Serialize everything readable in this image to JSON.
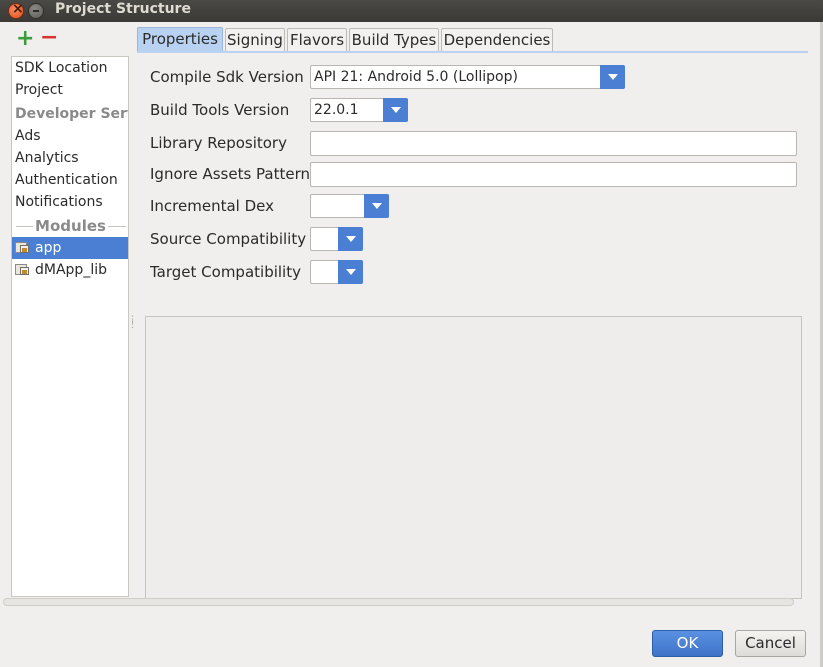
{
  "window": {
    "title": "Project Structure"
  },
  "sidebar": {
    "add_symbol": "+",
    "remove_symbol": "−",
    "items": [
      {
        "label": "SDK Location"
      },
      {
        "label": "Project"
      }
    ],
    "developer_section": "Developer Services",
    "services": [
      {
        "label": "Ads"
      },
      {
        "label": "Analytics"
      },
      {
        "label": "Authentication"
      },
      {
        "label": "Notifications"
      }
    ],
    "modules_header": "Modules",
    "modules": [
      {
        "label": "app",
        "selected": true
      },
      {
        "label": "dMApp_lib",
        "selected": false
      }
    ]
  },
  "tabs": [
    {
      "label": "Properties",
      "active": true
    },
    {
      "label": "Signing"
    },
    {
      "label": "Flavors"
    },
    {
      "label": "Build Types"
    },
    {
      "label": "Dependencies"
    }
  ],
  "form": {
    "compile_sdk": {
      "label": "Compile Sdk Version",
      "value": "API 21: Android 5.0 (Lollipop)"
    },
    "build_tools": {
      "label": "Build Tools Version",
      "value": "22.0.1"
    },
    "library_repository": {
      "label": "Library Repository",
      "value": ""
    },
    "ignore_assets": {
      "label": "Ignore Assets Pattern",
      "value": ""
    },
    "incremental_dex": {
      "label": "Incremental Dex",
      "value": ""
    },
    "source_compat": {
      "label": "Source Compatibility",
      "value": ""
    },
    "target_compat": {
      "label": "Target Compatibility",
      "value": ""
    }
  },
  "buttons": {
    "ok": "OK",
    "cancel": "Cancel"
  },
  "colors": {
    "accent": "#4a7fd4",
    "tab_active": "#b9d2f2",
    "add": "#3a9c3a",
    "remove": "#d6362e"
  }
}
